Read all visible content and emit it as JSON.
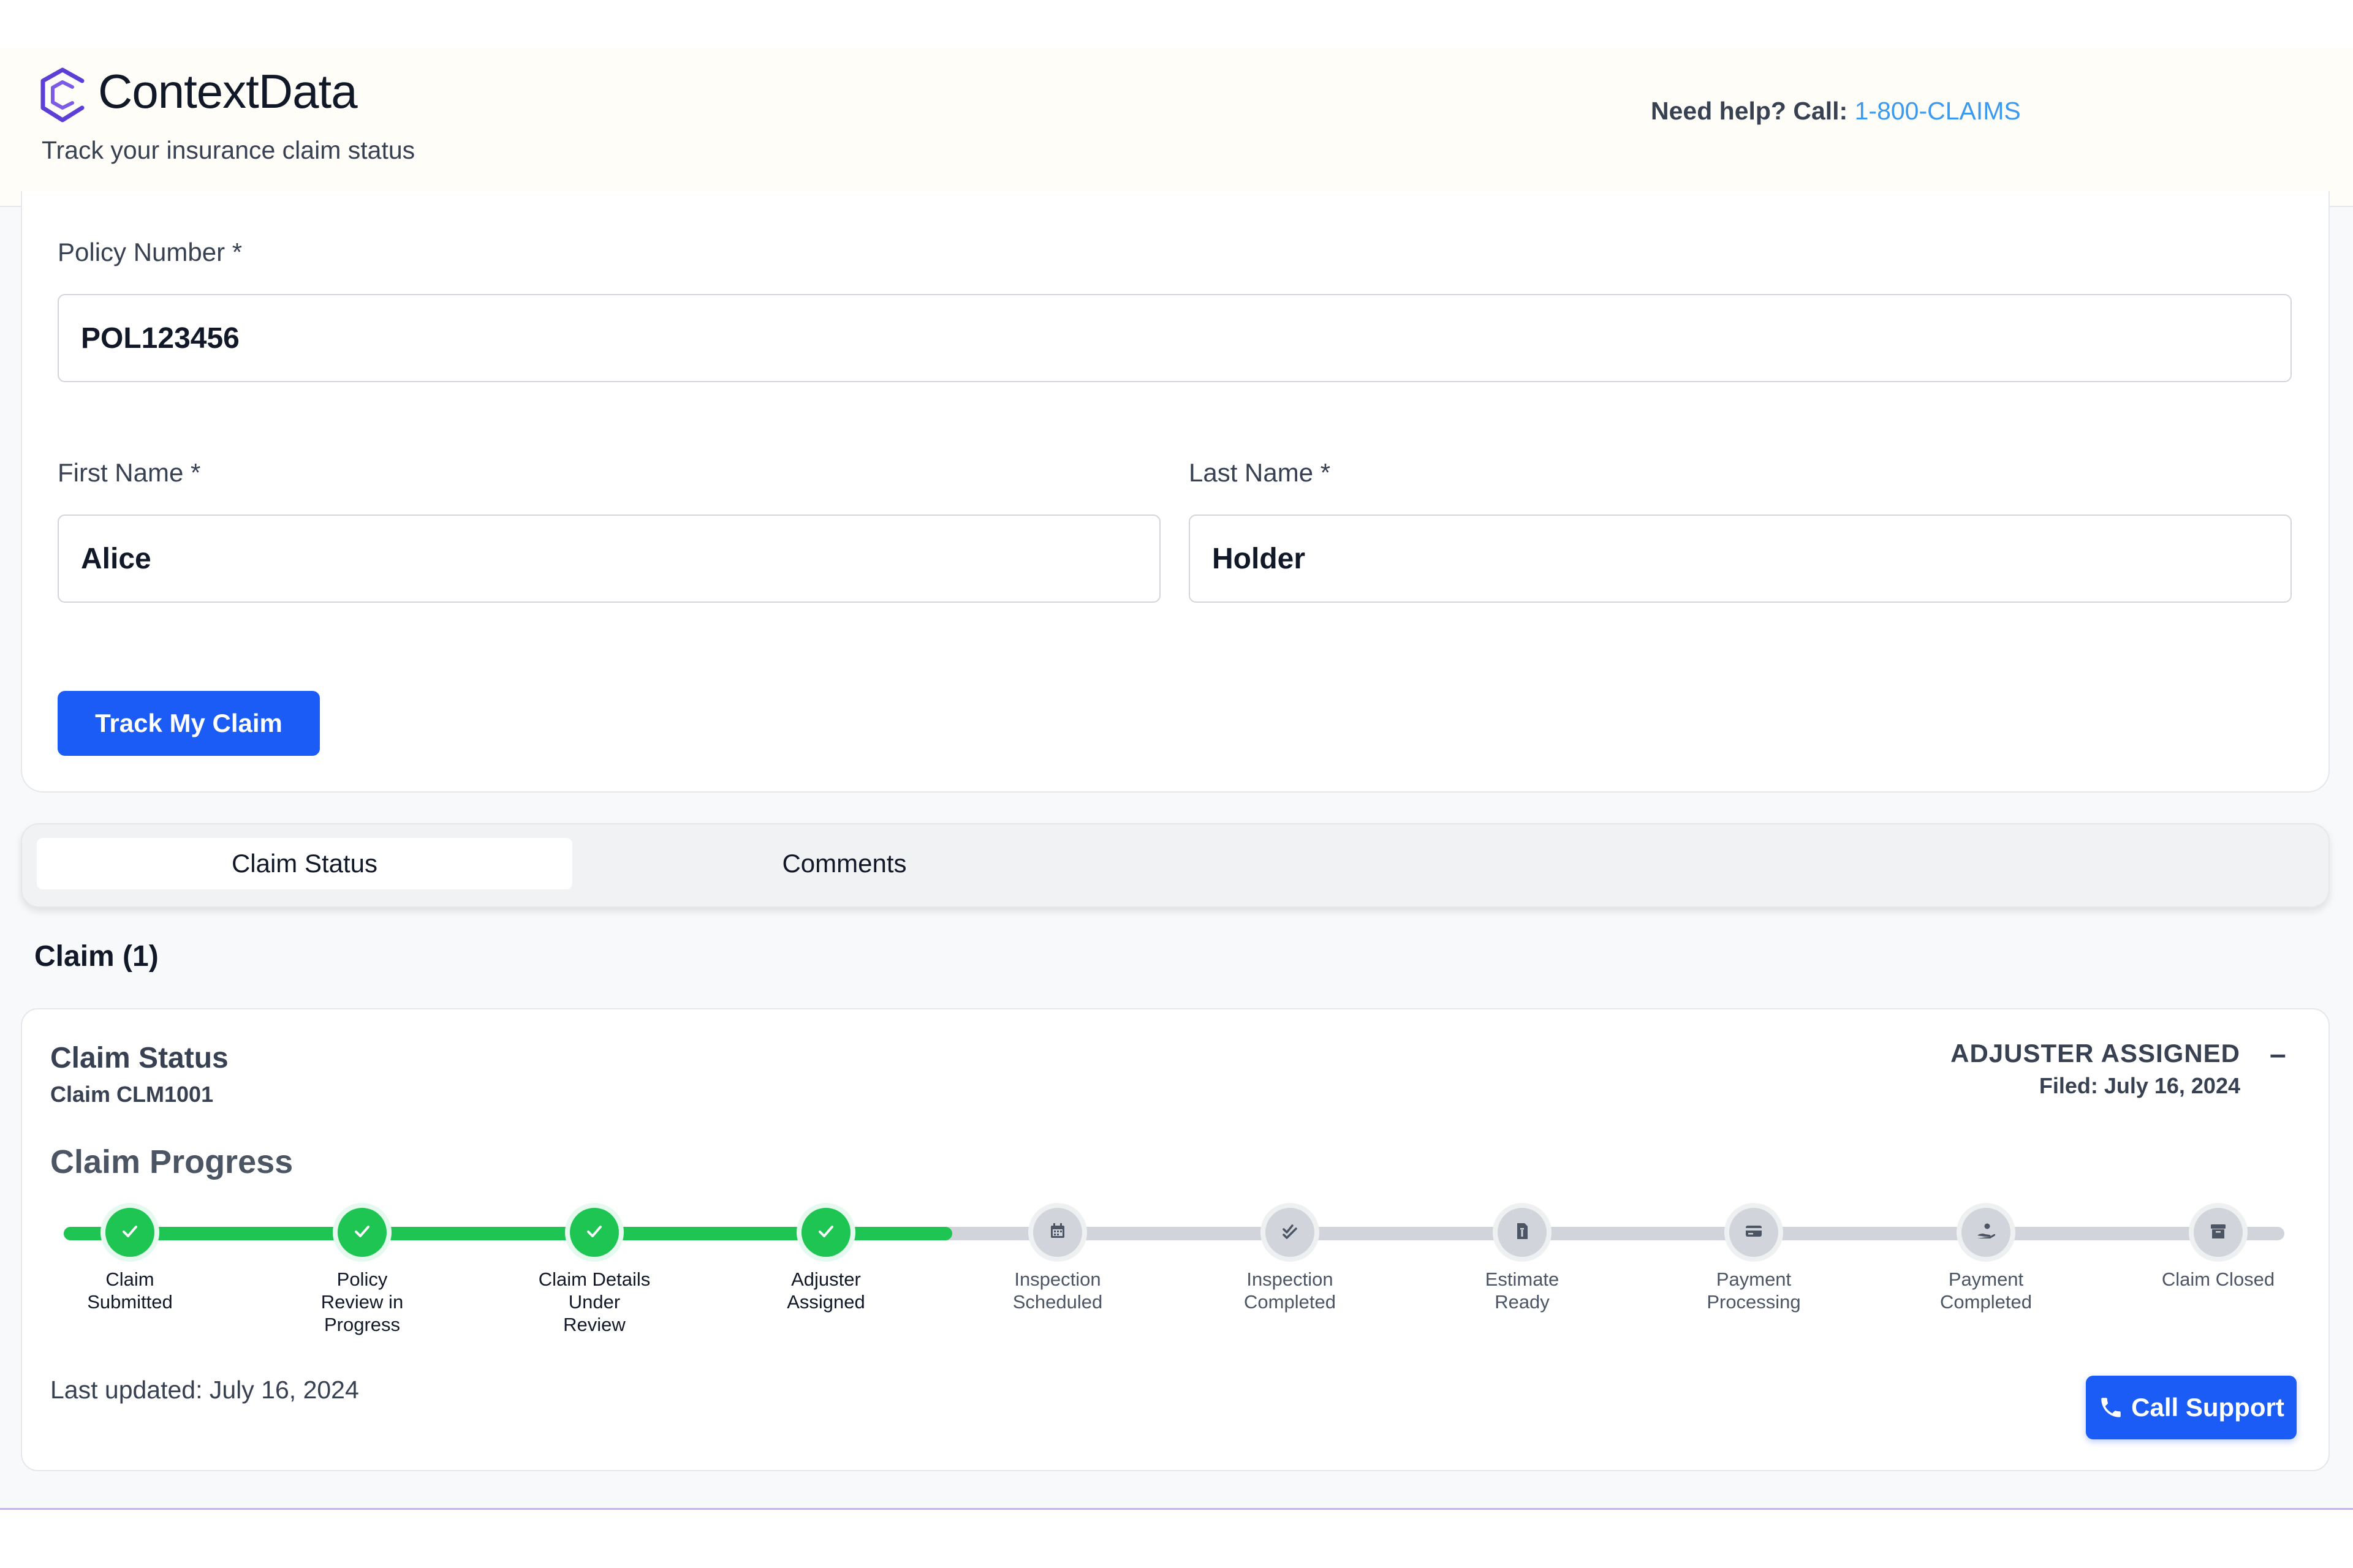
{
  "header": {
    "brand": "ContextData",
    "tagline": "Track your insurance claim status",
    "help_label": "Need help? Call: ",
    "help_phone": "1-800-CLAIMS"
  },
  "form": {
    "policy_label": "Policy Number *",
    "policy_value": "POL123456",
    "first_name_label": "First Name *",
    "first_name_value": "Alice",
    "last_name_label": "Last Name *",
    "last_name_value": "Holder",
    "submit_label": "Track My Claim"
  },
  "tabs": [
    {
      "label": "Claim Status",
      "active": true
    },
    {
      "label": "Comments",
      "active": false
    }
  ],
  "claims": {
    "heading": "Claim (1)",
    "card": {
      "title": "Claim Status",
      "claim_id": "Claim CLM1001",
      "status": "ADJUSTER ASSIGNED",
      "filed": "Filed: July 16, 2024",
      "collapse_symbol": "–",
      "progress_title": "Claim Progress",
      "last_updated": "Last updated: July 16, 2024",
      "call_label": "Call Support"
    }
  },
  "steps": [
    {
      "label_lines": [
        "Claim",
        "Submitted"
      ],
      "status": "done",
      "icon": "check-icon"
    },
    {
      "label_lines": [
        "Policy",
        "Review in",
        "Progress"
      ],
      "status": "done",
      "icon": "check-icon"
    },
    {
      "label_lines": [
        "Claim Details",
        "Under",
        "Review"
      ],
      "status": "done",
      "icon": "check-icon"
    },
    {
      "label_lines": [
        "Adjuster",
        "Assigned"
      ],
      "status": "done",
      "icon": "check-icon"
    },
    {
      "label_lines": [
        "Inspection",
        "Scheduled"
      ],
      "status": "todo",
      "icon": "calendar-icon"
    },
    {
      "label_lines": [
        "Inspection",
        "Completed"
      ],
      "status": "todo",
      "icon": "double-check-icon"
    },
    {
      "label_lines": [
        "Estimate",
        "Ready"
      ],
      "status": "todo",
      "icon": "document-icon"
    },
    {
      "label_lines": [
        "Payment",
        "Processing"
      ],
      "status": "todo",
      "icon": "credit-card-icon"
    },
    {
      "label_lines": [
        "Payment",
        "Completed"
      ],
      "status": "todo",
      "icon": "hand-coin-icon"
    },
    {
      "label_lines": [
        "Claim Closed"
      ],
      "status": "todo",
      "icon": "archive-icon"
    }
  ],
  "progress_fraction": 0.4,
  "colors": {
    "accent": "#1a5cf5",
    "done": "#1fc553",
    "pending": "#d1d5db",
    "link": "#3b9af0"
  }
}
